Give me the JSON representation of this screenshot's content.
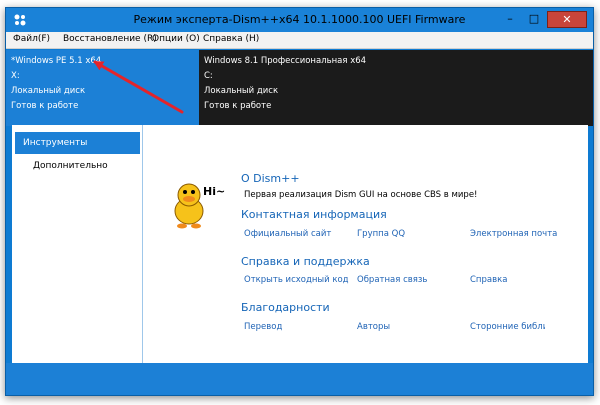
{
  "window": {
    "title": "Режим эксперта-Dism++x64 10.1.1000.100 UEFI Firmware"
  },
  "title_buttons": {
    "minimize": "–",
    "maximize": "□",
    "close": "✕"
  },
  "menu": [
    "Файл(F)",
    "Восстановление (R)",
    "Опции (O)",
    "Справка (H)"
  ],
  "images": {
    "left": [
      "*Windows PE 5.1 x64",
      "X:",
      "Локальный диск",
      "Готов к работе"
    ],
    "right": [
      "Windows 8.1 Профессиональная x64",
      "C:",
      "Локальный диск",
      "Готов к работе"
    ]
  },
  "sidebar": {
    "items": [
      "Инструменты",
      "Дополнительно"
    ]
  },
  "about": {
    "title": "О Dism++",
    "mascot_text": "Hi~",
    "description": "Первая реализация Dism GUI на основе CBS в мире!"
  },
  "contacts": {
    "title": "Контактная информация",
    "links": [
      "Официальный сайт",
      "Группа QQ",
      "Электронная почта"
    ]
  },
  "help": {
    "title": "Справка и поддержка",
    "links": [
      "Открыть исходный код",
      "Обратная связь",
      "Справка"
    ]
  },
  "thanks": {
    "title": "Благодарности",
    "links": [
      "Перевод",
      "Авторы",
      "Сторонние библиотеки"
    ]
  },
  "colors": {
    "accent": "#1c80d6",
    "dark_panel": "#1b1b1b",
    "link": "#1f63b5",
    "annotation_arrow": "#e3242b",
    "mascot": "#f6c21a"
  }
}
